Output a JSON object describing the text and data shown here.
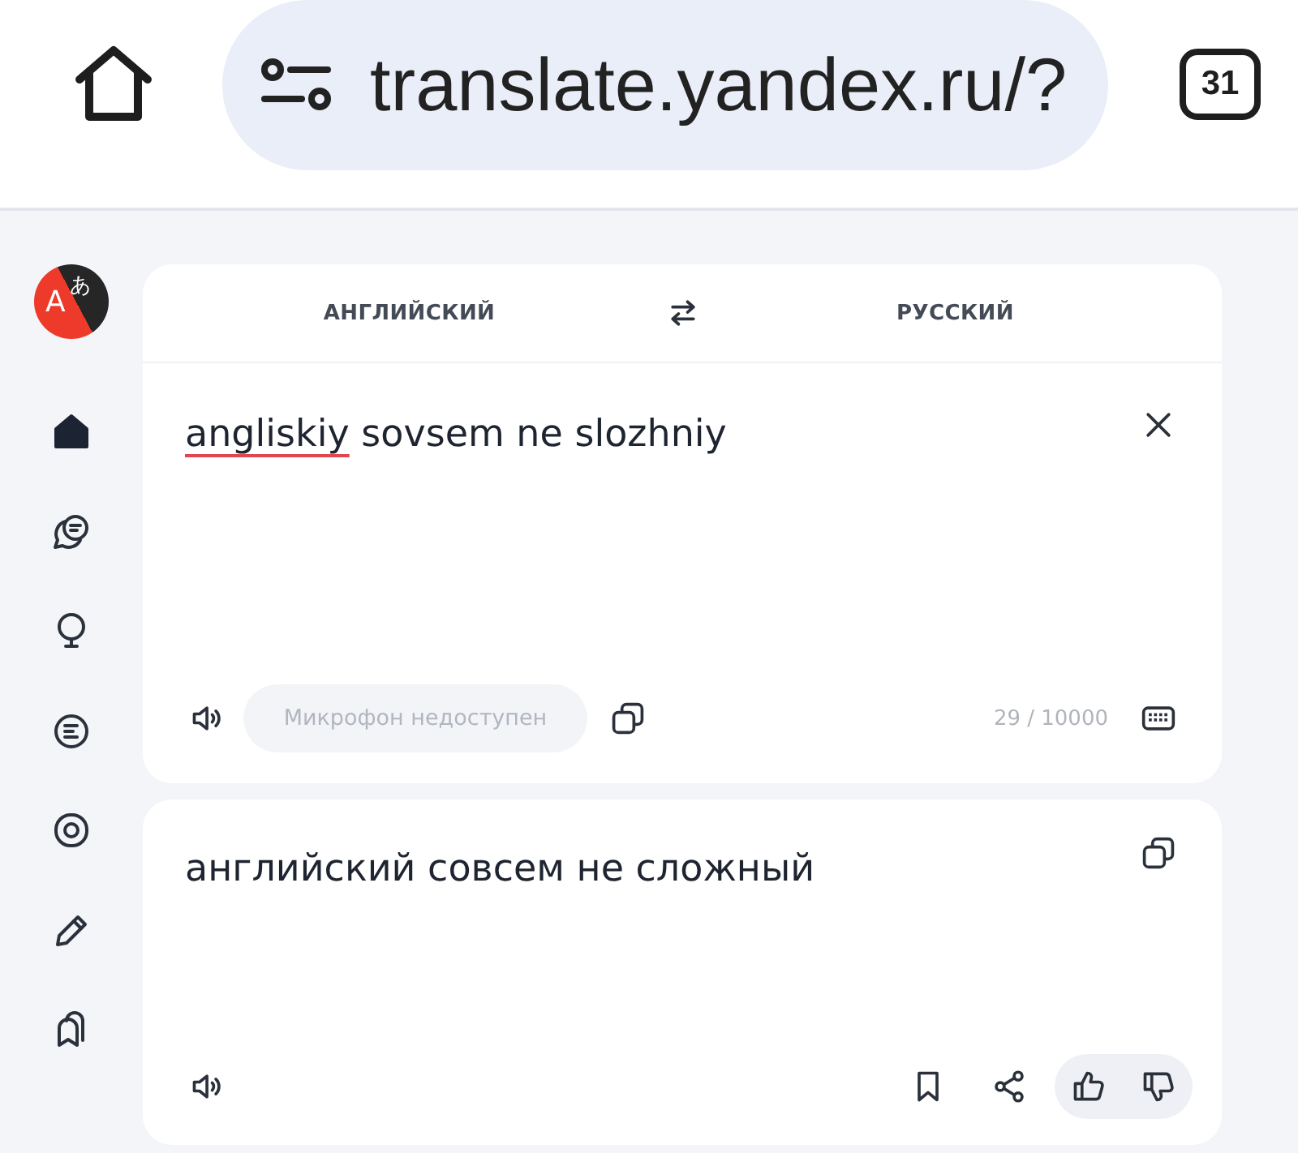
{
  "browser": {
    "url": "translate.yandex.ru/?",
    "tab_count": "31"
  },
  "logo": {
    "letters": [
      "A",
      "あ"
    ]
  },
  "sidebar": {
    "items": [
      {
        "selected": true
      },
      {
        "selected": false
      },
      {
        "selected": false
      },
      {
        "selected": false
      },
      {
        "selected": false
      },
      {
        "selected": false
      },
      {
        "selected": false
      }
    ]
  },
  "languages": {
    "source": "АНГЛИЙСКИЙ",
    "target": "РУССКИЙ"
  },
  "input": {
    "segments": [
      {
        "text": "angliskiy",
        "misspelled": true
      },
      {
        "text": " sovsem ne slozhniy",
        "misspelled": false
      }
    ],
    "mic_button": {
      "label": "Микрофон недоступен",
      "disabled": true
    },
    "counter": "29 / 10000"
  },
  "output": {
    "text": "английский совсем не сложный"
  }
}
